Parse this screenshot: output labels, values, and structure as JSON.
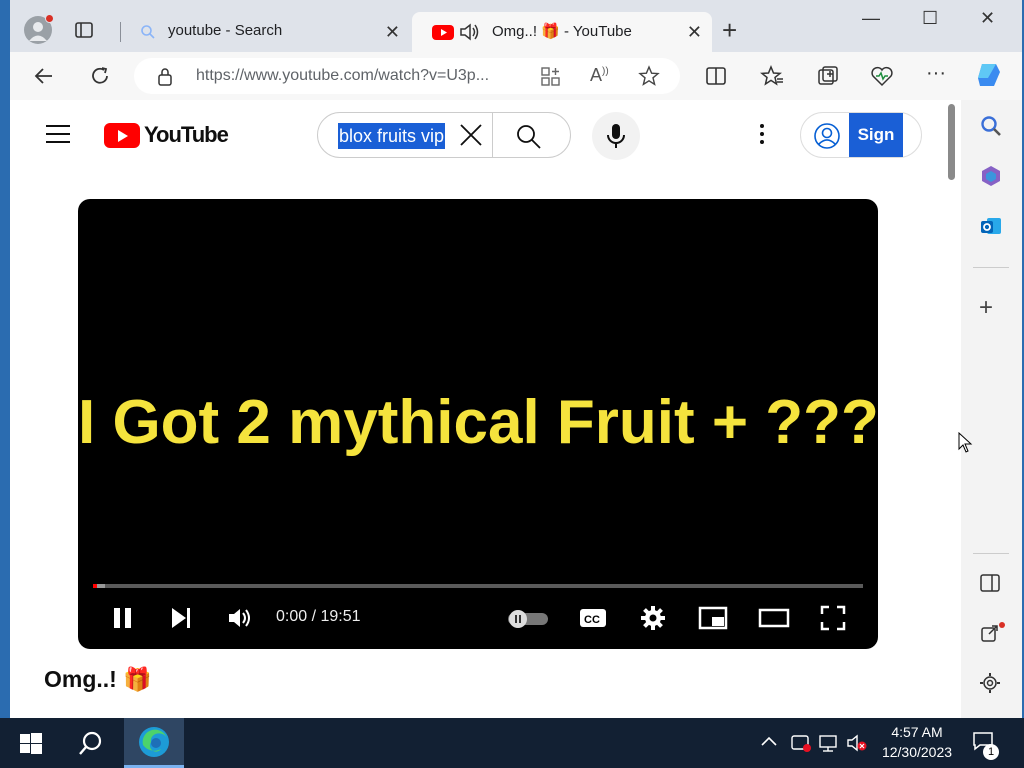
{
  "browser": {
    "tabs": [
      {
        "title": "youtube - Search",
        "active": false,
        "favicon": "search-icon"
      },
      {
        "title": "Omg..! 🎁 - YouTube",
        "active": true,
        "favicon": "youtube-icon",
        "audio": true
      }
    ],
    "address_bar": {
      "url": "https://www.youtube.com/watch?v=U3p..."
    }
  },
  "youtube": {
    "logo_text": "YouTube",
    "search": {
      "query": "blox fruits vip"
    },
    "signin_label": "Sign in"
  },
  "player": {
    "overlay_text": "I Got 2 mythical Fruit + ???",
    "time": "0:00 / 19:51",
    "progress": 0.005
  },
  "video": {
    "title": "Omg..! 🎁"
  },
  "taskbar": {
    "time": "4:57 AM",
    "date": "12/30/2023",
    "notification_count": "1"
  },
  "colors": {
    "youtube_red": "#ff0000",
    "selection_blue": "#1a5fd6",
    "overlay_yellow": "#f5e33d",
    "taskbar_bg": "#122033"
  }
}
